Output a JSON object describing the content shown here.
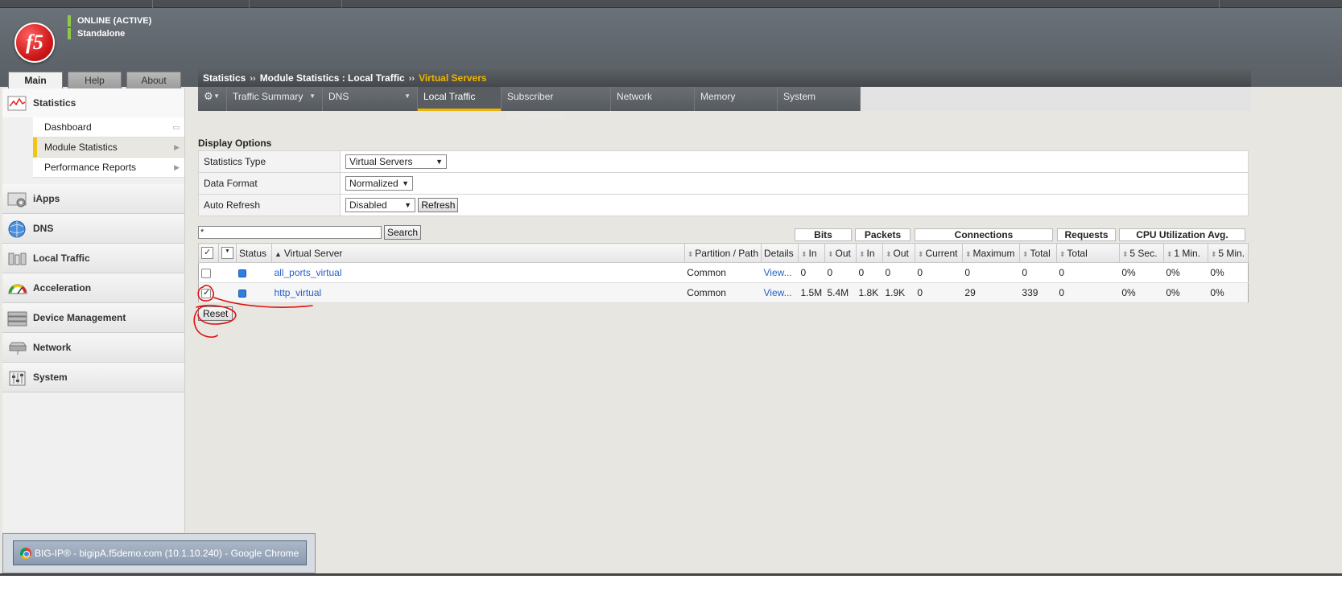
{
  "header": {
    "status_online": "ONLINE (ACTIVE)",
    "status_mode": "Standalone",
    "logo_text": "f5"
  },
  "main_tabs": [
    {
      "label": "Main",
      "active": true
    },
    {
      "label": "Help",
      "active": false
    },
    {
      "label": "About",
      "active": false
    }
  ],
  "sidebar": {
    "sections": [
      {
        "label": "Statistics",
        "icon": "statistics-chart-icon"
      },
      {
        "label": "iApps",
        "icon": "iapps-gear-icon"
      },
      {
        "label": "DNS",
        "icon": "globe-icon"
      },
      {
        "label": "Local Traffic",
        "icon": "local-traffic-icon"
      },
      {
        "label": "Acceleration",
        "icon": "speedometer-icon"
      },
      {
        "label": "Device Management",
        "icon": "device-stack-icon"
      },
      {
        "label": "Network",
        "icon": "network-switch-icon"
      },
      {
        "label": "System",
        "icon": "system-sliders-icon"
      }
    ],
    "statistics_items": [
      {
        "label": "Dashboard",
        "active": false
      },
      {
        "label": "Module Statistics",
        "active": true
      },
      {
        "label": "Performance Reports",
        "active": false
      }
    ]
  },
  "breadcrumb": {
    "part1": "Statistics",
    "part2": "Module Statistics : Local Traffic",
    "current": "Virtual Servers",
    "separator": "››"
  },
  "subtabs": [
    {
      "label": "Traffic Summary",
      "dropdown": true
    },
    {
      "label": "DNS",
      "dropdown": true
    },
    {
      "label": "Local Traffic",
      "dropdown": false,
      "active": true
    },
    {
      "label": "Subscriber Management",
      "dropdown": false
    },
    {
      "label": "Network",
      "dropdown": false
    },
    {
      "label": "Memory",
      "dropdown": false
    },
    {
      "label": "System",
      "dropdown": false
    }
  ],
  "display_options": {
    "title": "Display Options",
    "statistics_type_label": "Statistics Type",
    "statistics_type_value": "Virtual Servers",
    "data_format_label": "Data Format",
    "data_format_value": "Normalized",
    "auto_refresh_label": "Auto Refresh",
    "auto_refresh_value": "Disabled",
    "refresh_button": "Refresh"
  },
  "search": {
    "value": "*",
    "button": "Search"
  },
  "table": {
    "groups": {
      "bits": "Bits",
      "packets": "Packets",
      "connections": "Connections",
      "requests": "Requests",
      "cpu": "CPU Utilization Avg."
    },
    "columns": {
      "status": "Status",
      "virtual_server": "Virtual Server",
      "partition": "Partition / Path",
      "details": "Details",
      "bits_in": "In",
      "bits_out": "Out",
      "packets_in": "In",
      "packets_out": "Out",
      "conn_current": "Current",
      "conn_max": "Maximum",
      "conn_total": "Total",
      "req_total": "Total",
      "cpu_5sec": "5 Sec.",
      "cpu_1min": "1 Min.",
      "cpu_5min": "5 Min."
    },
    "rows": [
      {
        "checked": false,
        "name": "all_ports_virtual",
        "partition": "Common",
        "details": "View...",
        "bits_in": "0",
        "bits_out": "0",
        "packets_in": "0",
        "packets_out": "0",
        "conn_current": "0",
        "conn_max": "0",
        "conn_total": "0",
        "req_total": "0",
        "cpu_5sec": "0%",
        "cpu_1min": "0%",
        "cpu_5min": "0%"
      },
      {
        "checked": true,
        "name": "http_virtual",
        "partition": "Common",
        "details": "View...",
        "bits_in": "1.5M",
        "bits_out": "5.4M",
        "packets_in": "1.8K",
        "packets_out": "1.9K",
        "conn_current": "0",
        "conn_max": "29",
        "conn_total": "339",
        "req_total": "0",
        "cpu_5sec": "0%",
        "cpu_1min": "0%",
        "cpu_5min": "0%"
      }
    ],
    "reset_button": "Reset"
  },
  "taskbar": {
    "window_title": "BIG-IP® - bigipA.f5demo.com (10.1.10.240) - Google Chrome"
  },
  "colors": {
    "accent": "#f0b400",
    "link": "#2561c6",
    "annotation": "#e01010"
  }
}
